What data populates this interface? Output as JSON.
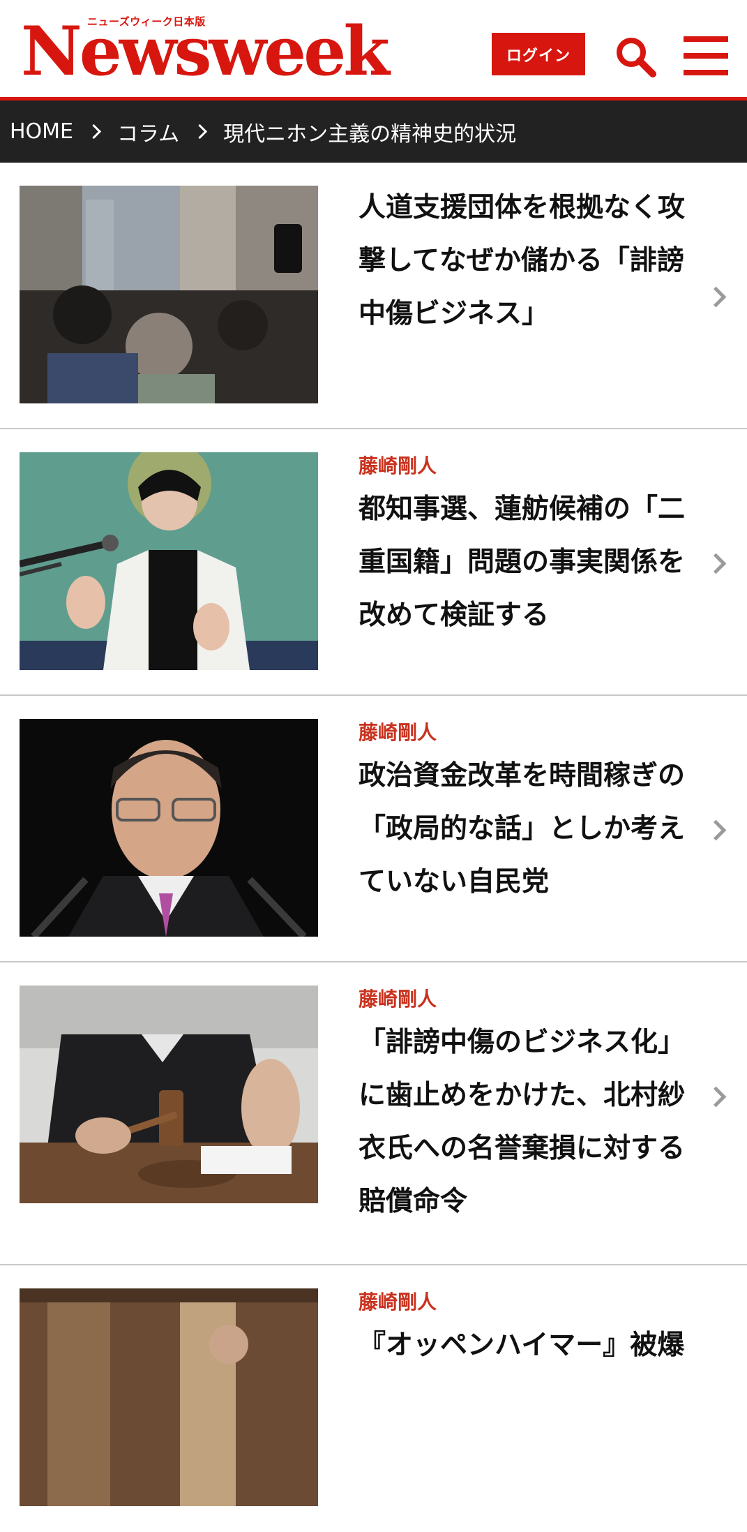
{
  "header": {
    "logo_sub": "ニューズウィーク日本版",
    "logo_main": "Newsweek",
    "login_label": "ログイン"
  },
  "breadcrumb": {
    "items": [
      "HOME",
      "コラム",
      "現代ニホン主義の精神史的状況"
    ]
  },
  "colors": {
    "brand_red": "#d7170f",
    "author_red": "#c8321e",
    "breadcrumb_bg": "#222222"
  },
  "articles": [
    {
      "author": "",
      "title": "人道支援団体を根拠なく攻撃してなぜか儲かる「誹謗中傷ビジネス」",
      "image": "crowd-photo"
    },
    {
      "author": "藤崎剛人",
      "title": "都知事選、蓮舫候補の「二重国籍」問題の事実関係を改めて検証する",
      "image": "press-conference-photo"
    },
    {
      "author": "藤崎剛人",
      "title": "政治資金改革を時間稼ぎの「政局的な話」としか考えていない自民党",
      "image": "politician-photo"
    },
    {
      "author": "藤崎剛人",
      "title": "「誹謗中傷のビジネス化」に歯止めをかけた、北村紗衣氏への名誉棄損に対する賠償命令",
      "image": "judge-gavel-photo"
    },
    {
      "author": "藤崎剛人",
      "title": "『オッペンハイマー』被爆",
      "image": "partial-photo"
    }
  ]
}
